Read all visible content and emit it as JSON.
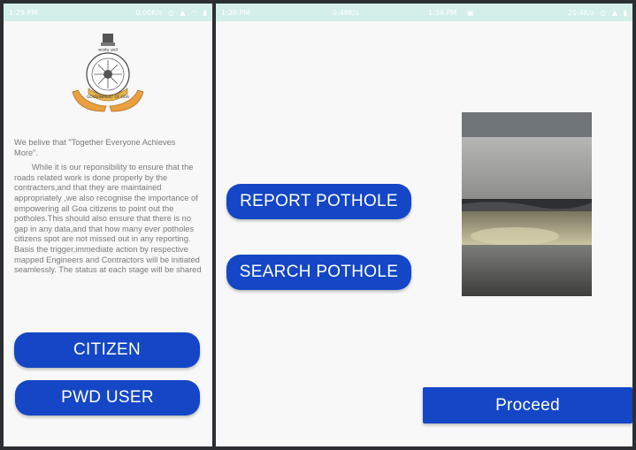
{
  "left_screen": {
    "status_bar": {
      "time": "1:29 PM",
      "speed": "0.00K/s",
      "icons": [
        "alarm-icon",
        "signal-icon",
        "wifi-icon",
        "battery-icon"
      ]
    },
    "logo": {
      "alt": "Government of Goa emblem",
      "motto_top": "सत्यमेव जयते",
      "ring_text": "GOVERNMENT OF GOA"
    },
    "about": {
      "intro": "We belive that \"Together Everyone Achieves More\".",
      "body": "While it is our reponsibility to ensure that the roads related work is done properly by the contracters,and that they are maintained appropriately ,we also recognise the importance of empowering all Goa citizens to point out the potholes.This should also ensure that there is no gap in any data,and that how many ever potholes citizens spot are not missed out in any reporting. Basis the trigger,immediate action by respective mapped Engineers and Contractors will be initiated seamlessly. The status at each stage will be shared"
    },
    "buttons": {
      "citizen": "CITIZEN",
      "pwd_user": "PWD USER"
    }
  },
  "middle_screen": {
    "status_bar": {
      "time": "1:29 PM",
      "speed": "0.48K/s"
    },
    "buttons": {
      "report_pothole": "REPORT POTHOLE",
      "search_pothole": "SEARCH POTHOLE"
    }
  },
  "right_screen": {
    "status_bar": {
      "time": "1:34 PM",
      "speed": "20.4K/s"
    },
    "photo": {
      "description": "pothole-photo"
    },
    "buttons": {
      "proceed": "Proceed"
    }
  },
  "colors": {
    "button_blue": "#1446c6",
    "status_bar": "#d4efea",
    "body_text": "#7a7a7a",
    "background": "#f8f8f8"
  }
}
